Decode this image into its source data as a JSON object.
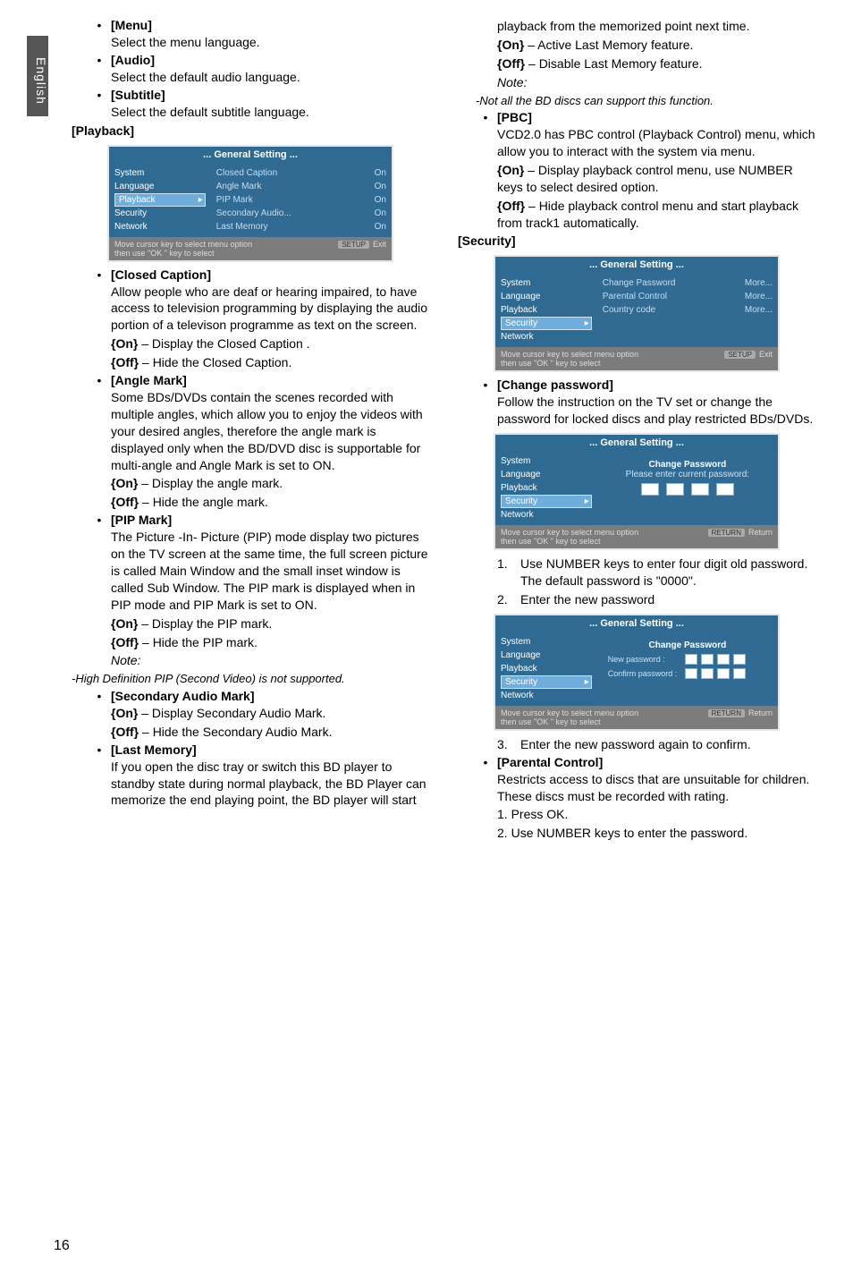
{
  "side_tab": "English",
  "page_number": "16",
  "left": {
    "menu": {
      "head": "[Menu]",
      "desc": "Select the menu language."
    },
    "audio": {
      "head": "[Audio]",
      "desc": "Select the default audio language."
    },
    "subtitle": {
      "head": "[Subtitle]",
      "desc": "Select the default subtitle language."
    },
    "playback_head": "[Playback]",
    "osd_playback": {
      "title": "... General Setting ...",
      "left": [
        "System",
        "Language",
        "Playback",
        "Security",
        "Network"
      ],
      "rows": [
        {
          "k": "Closed Caption",
          "v": "On"
        },
        {
          "k": "Angle Mark",
          "v": "On"
        },
        {
          "k": "PIP Mark",
          "v": "On"
        },
        {
          "k": "Secondary Audio...",
          "v": "On"
        },
        {
          "k": "Last Memory",
          "v": "On"
        }
      ],
      "foot1": "Move cursor key to select menu option",
      "foot2": "then use \"OK \" key to select",
      "exit_btn": "SETUP",
      "exit": "Exit"
    },
    "closed_caption": {
      "head": "[Closed Caption]",
      "desc": "Allow people who are deaf or hearing impaired, to have access to television programming by displaying the audio portion of a televison programme as text on the screen.",
      "on": "{On} – Display the Closed Caption .",
      "off": "{Off} – Hide the Closed Caption."
    },
    "angle_mark": {
      "head": "[Angle Mark]",
      "desc": "Some BDs/DVDs contain the scenes recorded with multiple angles, which allow you to enjoy the videos with your desired angles, therefore the angle mark is displayed only when the BD/DVD disc is supportable for multi-angle and Angle Mark is set to ON.",
      "on": "{On} – Display the angle mark.",
      "off": "{Off} – Hide the angle mark."
    },
    "pip_mark": {
      "head": "[PIP Mark]",
      "desc": "The Picture -In- Picture (PIP) mode display two pictures on the TV screen at the same time, the full screen picture is called Main Window and the small inset window is called Sub Window. The PIP mark is displayed when in PIP mode and PIP Mark is set to ON.",
      "on": "{On} – Display the PIP mark.",
      "off": "{Off} – Hide the PIP mark.",
      "note_label": "Note:",
      "note": "-High Definition PIP (Second Video) is not supported."
    },
    "sec_audio": {
      "head": "[Secondary Audio Mark]",
      "on": "{On} – Display Secondary Audio Mark.",
      "off": "{Off} – Hide the Secondary Audio Mark."
    },
    "last_memory": {
      "head": "[Last Memory]",
      "desc": "If you open the disc tray or switch this BD player to standby state during normal playback, the BD Player can memorize the end playing point, the BD player will start"
    }
  },
  "right": {
    "cont": {
      "desc": "playback from the memorized point next time.",
      "on": "{On} – Active Last Memory feature.",
      "off": "{Off} – Disable Last Memory feature.",
      "note_label": "Note:",
      "note": "-Not all the BD discs can support this function."
    },
    "pbc": {
      "head": "[PBC]",
      "desc": "VCD2.0 has PBC control (Playback Control) menu, which allow you to interact with the system via menu.",
      "on": "{On} – Display playback control menu, use NUMBER keys to select desired option.",
      "off": "{Off} – Hide playback control menu and start playback from track1 automatically."
    },
    "security_head": "[Security]",
    "osd_security": {
      "title": "... General Setting ...",
      "left": [
        "System",
        "Language",
        "Playback",
        "Security",
        "Network"
      ],
      "rows": [
        {
          "k": "Change Password",
          "v": "More..."
        },
        {
          "k": "Parental Control",
          "v": "More..."
        },
        {
          "k": "Country code",
          "v": "More..."
        }
      ],
      "foot1": "Move cursor key to select menu option",
      "foot2": "then use \"OK \" key to select",
      "exit_btn": "SETUP",
      "exit": "Exit"
    },
    "change_pw": {
      "head": "[Change password]",
      "desc": "Follow the instruction on the TV set or change the password for locked discs and play restricted BDs/DVDs."
    },
    "osd_pw1": {
      "title": "... General Setting ...",
      "left": [
        "System",
        "Language",
        "Playback",
        "Security",
        "Network"
      ],
      "cp_title": "Change Password",
      "pw_label": "Please enter current password:",
      "foot1": "Move cursor key to select menu option",
      "foot2": "then use \"OK \" key to select",
      "exit_btn": "RETURN",
      "exit": "Return"
    },
    "steps1": {
      "s1": "Use NUMBER keys to enter four digit old password. The default password is \"0000\".",
      "s2": "Enter the new password"
    },
    "osd_pw2": {
      "title": "... General Setting ...",
      "left": [
        "System",
        "Language",
        "Playback",
        "Security",
        "Network"
      ],
      "cp_title": "Change Password",
      "new_pw": "New password :",
      "conf_pw": "Confirm password :",
      "foot1": "Move cursor key to select menu option",
      "foot2": "then use \"OK \" key to select",
      "exit_btn": "RETURN",
      "exit": "Return"
    },
    "step3": "Enter the new password again to confirm.",
    "parental": {
      "head": "[Parental Control]",
      "desc": "Restricts access to discs that are unsuitable for children. These discs must be recorded with rating.",
      "s1": "Press OK.",
      "s2": "Use NUMBER keys to enter the password."
    }
  }
}
